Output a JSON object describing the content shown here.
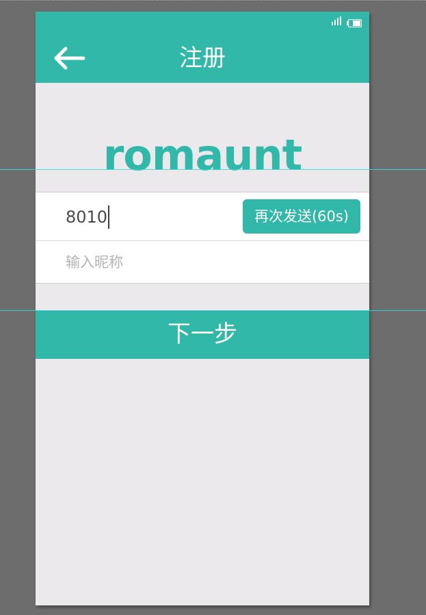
{
  "header": {
    "title": "注册"
  },
  "logo": {
    "text": "romaunt"
  },
  "form": {
    "code_value": "8010",
    "resend_label": "再次发送(60s)",
    "nickname_placeholder": "输入昵称"
  },
  "actions": {
    "next_label": "下一步"
  },
  "icons": {
    "back": "back-arrow-icon",
    "signal": "signal-icon",
    "battery": "battery-icon"
  },
  "colors": {
    "accent": "#31b8a9",
    "background": "#ebe9ec",
    "canvas": "#6d6d6d",
    "white": "#ffffff",
    "placeholder": "#b3b3b3",
    "guide": "#39d7dc"
  }
}
